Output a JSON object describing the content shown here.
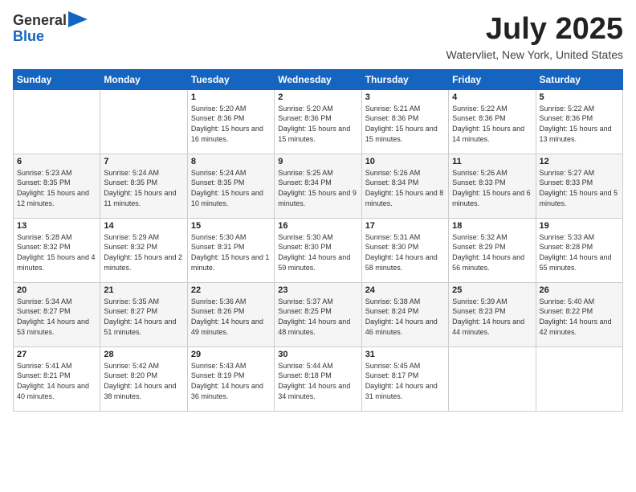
{
  "header": {
    "logo": {
      "line1": "General",
      "line2": "Blue"
    },
    "title": "July 2025",
    "subtitle": "Watervliet, New York, United States"
  },
  "calendar": {
    "days_of_week": [
      "Sunday",
      "Monday",
      "Tuesday",
      "Wednesday",
      "Thursday",
      "Friday",
      "Saturday"
    ],
    "weeks": [
      [
        {
          "day": "",
          "info": ""
        },
        {
          "day": "",
          "info": ""
        },
        {
          "day": "1",
          "info": "Sunrise: 5:20 AM\nSunset: 8:36 PM\nDaylight: 15 hours and 16 minutes."
        },
        {
          "day": "2",
          "info": "Sunrise: 5:20 AM\nSunset: 8:36 PM\nDaylight: 15 hours and 15 minutes."
        },
        {
          "day": "3",
          "info": "Sunrise: 5:21 AM\nSunset: 8:36 PM\nDaylight: 15 hours and 15 minutes."
        },
        {
          "day": "4",
          "info": "Sunrise: 5:22 AM\nSunset: 8:36 PM\nDaylight: 15 hours and 14 minutes."
        },
        {
          "day": "5",
          "info": "Sunrise: 5:22 AM\nSunset: 8:36 PM\nDaylight: 15 hours and 13 minutes."
        }
      ],
      [
        {
          "day": "6",
          "info": "Sunrise: 5:23 AM\nSunset: 8:35 PM\nDaylight: 15 hours and 12 minutes."
        },
        {
          "day": "7",
          "info": "Sunrise: 5:24 AM\nSunset: 8:35 PM\nDaylight: 15 hours and 11 minutes."
        },
        {
          "day": "8",
          "info": "Sunrise: 5:24 AM\nSunset: 8:35 PM\nDaylight: 15 hours and 10 minutes."
        },
        {
          "day": "9",
          "info": "Sunrise: 5:25 AM\nSunset: 8:34 PM\nDaylight: 15 hours and 9 minutes."
        },
        {
          "day": "10",
          "info": "Sunrise: 5:26 AM\nSunset: 8:34 PM\nDaylight: 15 hours and 8 minutes."
        },
        {
          "day": "11",
          "info": "Sunrise: 5:26 AM\nSunset: 8:33 PM\nDaylight: 15 hours and 6 minutes."
        },
        {
          "day": "12",
          "info": "Sunrise: 5:27 AM\nSunset: 8:33 PM\nDaylight: 15 hours and 5 minutes."
        }
      ],
      [
        {
          "day": "13",
          "info": "Sunrise: 5:28 AM\nSunset: 8:32 PM\nDaylight: 15 hours and 4 minutes."
        },
        {
          "day": "14",
          "info": "Sunrise: 5:29 AM\nSunset: 8:32 PM\nDaylight: 15 hours and 2 minutes."
        },
        {
          "day": "15",
          "info": "Sunrise: 5:30 AM\nSunset: 8:31 PM\nDaylight: 15 hours and 1 minute."
        },
        {
          "day": "16",
          "info": "Sunrise: 5:30 AM\nSunset: 8:30 PM\nDaylight: 14 hours and 59 minutes."
        },
        {
          "day": "17",
          "info": "Sunrise: 5:31 AM\nSunset: 8:30 PM\nDaylight: 14 hours and 58 minutes."
        },
        {
          "day": "18",
          "info": "Sunrise: 5:32 AM\nSunset: 8:29 PM\nDaylight: 14 hours and 56 minutes."
        },
        {
          "day": "19",
          "info": "Sunrise: 5:33 AM\nSunset: 8:28 PM\nDaylight: 14 hours and 55 minutes."
        }
      ],
      [
        {
          "day": "20",
          "info": "Sunrise: 5:34 AM\nSunset: 8:27 PM\nDaylight: 14 hours and 53 minutes."
        },
        {
          "day": "21",
          "info": "Sunrise: 5:35 AM\nSunset: 8:27 PM\nDaylight: 14 hours and 51 minutes."
        },
        {
          "day": "22",
          "info": "Sunrise: 5:36 AM\nSunset: 8:26 PM\nDaylight: 14 hours and 49 minutes."
        },
        {
          "day": "23",
          "info": "Sunrise: 5:37 AM\nSunset: 8:25 PM\nDaylight: 14 hours and 48 minutes."
        },
        {
          "day": "24",
          "info": "Sunrise: 5:38 AM\nSunset: 8:24 PM\nDaylight: 14 hours and 46 minutes."
        },
        {
          "day": "25",
          "info": "Sunrise: 5:39 AM\nSunset: 8:23 PM\nDaylight: 14 hours and 44 minutes."
        },
        {
          "day": "26",
          "info": "Sunrise: 5:40 AM\nSunset: 8:22 PM\nDaylight: 14 hours and 42 minutes."
        }
      ],
      [
        {
          "day": "27",
          "info": "Sunrise: 5:41 AM\nSunset: 8:21 PM\nDaylight: 14 hours and 40 minutes."
        },
        {
          "day": "28",
          "info": "Sunrise: 5:42 AM\nSunset: 8:20 PM\nDaylight: 14 hours and 38 minutes."
        },
        {
          "day": "29",
          "info": "Sunrise: 5:43 AM\nSunset: 8:19 PM\nDaylight: 14 hours and 36 minutes."
        },
        {
          "day": "30",
          "info": "Sunrise: 5:44 AM\nSunset: 8:18 PM\nDaylight: 14 hours and 34 minutes."
        },
        {
          "day": "31",
          "info": "Sunrise: 5:45 AM\nSunset: 8:17 PM\nDaylight: 14 hours and 31 minutes."
        },
        {
          "day": "",
          "info": ""
        },
        {
          "day": "",
          "info": ""
        }
      ]
    ]
  }
}
